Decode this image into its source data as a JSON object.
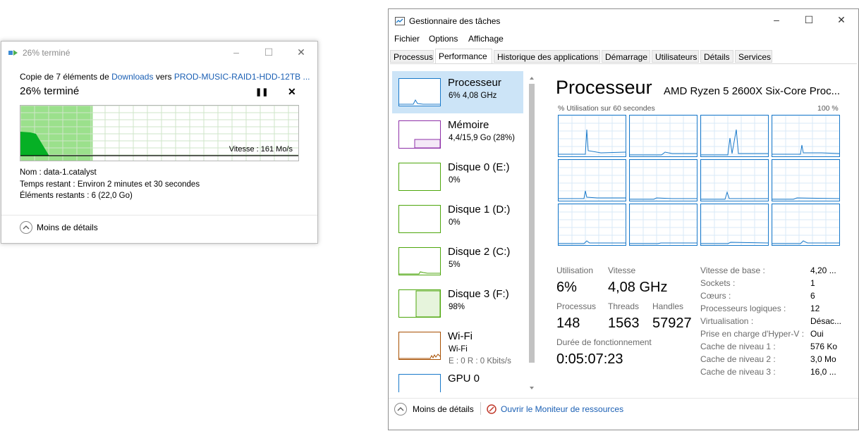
{
  "copy_dialog": {
    "title": "26% terminé",
    "line1": {
      "prefix": "Copie de 7 éléments de",
      "source": "Downloads",
      "middle": "vers",
      "dest": "PROD-MUSIC-RAID1-HDD-12TB ..."
    },
    "percent_text": "26% terminé",
    "progress_fraction": 0.26,
    "speed_text": "Vitesse : 161 Mo/s",
    "name_label": "Nom :",
    "name_value": "data-1.catalyst",
    "time_label": "Temps restant :",
    "time_value": "Environ 2 minutes et 30 secondes",
    "items_label": "Éléments restants :",
    "items_value": "6 (22,0 Go)",
    "details_label": "Moins de détails",
    "colors": {
      "fill": "#9be08c",
      "area": "#06b025",
      "link": "#1a5fb4"
    }
  },
  "task_manager": {
    "title": "Gestionnaire des tâches",
    "menu": [
      "Fichier",
      "Options",
      "Affichage"
    ],
    "tabs": [
      "Processus",
      "Performance",
      "Historique des applications",
      "Démarrage",
      "Utilisateurs",
      "Détails",
      "Services"
    ],
    "active_tab": "Performance",
    "resources": [
      {
        "name": "Processeur",
        "sub": "6% 4,08 GHz",
        "color": "#1979ca",
        "selected": true
      },
      {
        "name": "Mémoire",
        "sub": "4,4/15,9 Go (28%)",
        "color": "#8e30a8"
      },
      {
        "name": "Disque 0 (E:)",
        "sub": "0%",
        "color": "#4da60c"
      },
      {
        "name": "Disque 1 (D:)",
        "sub": "0%",
        "color": "#4da60c"
      },
      {
        "name": "Disque 2 (C:)",
        "sub": "5%",
        "color": "#4da60c"
      },
      {
        "name": "Disque 3 (F:)",
        "sub": "98%",
        "color": "#4da60c"
      },
      {
        "name": "Wi-Fi",
        "sub": "Wi-Fi",
        "sub2": "E : 0 R : 0 Kbits/s",
        "color": "#a74f01"
      },
      {
        "name": "GPU 0",
        "sub": "",
        "color": "#1979ca"
      }
    ],
    "cpu": {
      "heading": "Processeur",
      "model": "AMD Ryzen 5 2600X Six-Core Proc...",
      "graph_label": "% Utilisation sur 60 secondes",
      "graph_max": "100 %",
      "utilisation_label": "Utilisation",
      "utilisation_value": "6%",
      "vitesse_label": "Vitesse",
      "vitesse_value": "4,08 GHz",
      "processus_label": "Processus",
      "processus_value": "148",
      "threads_label": "Threads",
      "threads_value": "1563",
      "handles_label": "Handles",
      "handles_value": "57927",
      "uptime_label": "Durée de fonctionnement",
      "uptime_value": "0:05:07:23",
      "details": [
        {
          "label": "Vitesse de base :",
          "value": "4,20 ..."
        },
        {
          "label": "Sockets :",
          "value": "1"
        },
        {
          "label": "Cœurs :",
          "value": "6"
        },
        {
          "label": "Processeurs logiques :",
          "value": "12"
        },
        {
          "label": "Virtualisation :",
          "value": "Désac..."
        },
        {
          "label": "Prise en charge d'Hyper-V :",
          "value": "Oui"
        },
        {
          "label": "Cache de niveau 1 :",
          "value": "576 Ko"
        },
        {
          "label": "Cache de niveau 2 :",
          "value": "3,0 Mo"
        },
        {
          "label": "Cache de niveau 3 :",
          "value": "16,0 ..."
        }
      ]
    },
    "footer": {
      "less_details": "Moins de détails",
      "resource_monitor": "Ouvrir le Moniteur de ressources"
    }
  }
}
